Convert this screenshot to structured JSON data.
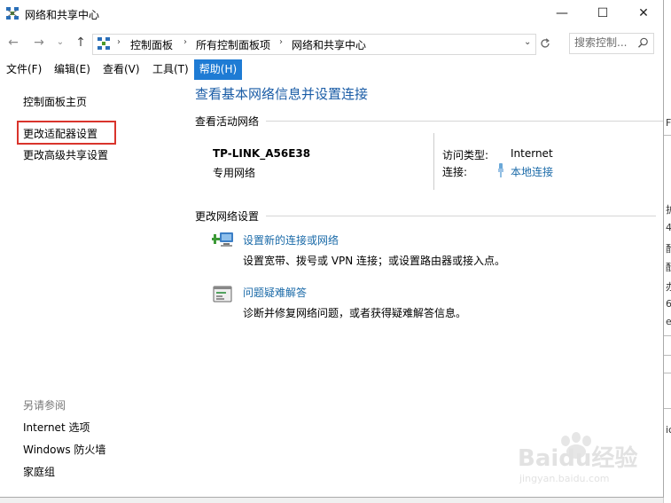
{
  "window": {
    "title": "网络和共享中心",
    "controls": {
      "minimize": "—",
      "maximize": "☐",
      "close": "✕"
    }
  },
  "address_bar": {
    "back": "←",
    "forward": "→",
    "history": "⌄",
    "up": "↑",
    "breadcrumbs": [
      "控制面板",
      "所有控制面板项",
      "网络和共享中心"
    ],
    "dropdown": "⌄",
    "search_placeholder": "搜索控制..."
  },
  "menu": [
    {
      "label": "文件(F)"
    },
    {
      "label": "编辑(E)"
    },
    {
      "label": "查看(V)"
    },
    {
      "label": "工具(T)"
    },
    {
      "label": "帮助(H)",
      "active": true
    }
  ],
  "left_pane": {
    "home": "控制面板主页",
    "links": [
      "更改适配器设置",
      "更改高级共享设置"
    ],
    "see_also_title": "另请参阅",
    "see_also": [
      "Internet 选项",
      "Windows 防火墙",
      "家庭组"
    ]
  },
  "main": {
    "title": "查看基本网络信息并设置连接",
    "active_networks_header": "查看活动网络",
    "network": {
      "name": "TP-LINK_A56E38",
      "category": "专用网络",
      "access_type_label": "访问类型:",
      "access_type_value": "Internet",
      "connection_label": "连接:",
      "connection_value": "本地连接"
    },
    "change_settings_header": "更改网络设置",
    "tasks": [
      {
        "icon": "network-setup-icon",
        "title": "设置新的连接或网络",
        "desc": "设置宽带、拨号或 VPN 连接；或设置路由器或接入点。"
      },
      {
        "icon": "troubleshoot-icon",
        "title": "问题疑难解答",
        "desc": "诊断并修复网络问题，或者获得疑难解答信息。"
      }
    ]
  },
  "background_window_chars": [
    "F",
    "护",
    "4",
    "酌",
    "酝",
    "办",
    "6",
    "e",
    "ic"
  ],
  "watermark": {
    "text": "Baidu经验",
    "url_text": "jingyan.baidu.com"
  },
  "colors": {
    "menu_active": "#1e7bd4",
    "link": "#1a6aa8",
    "title": "#1a5ca6",
    "highlight": "#d9342c"
  }
}
